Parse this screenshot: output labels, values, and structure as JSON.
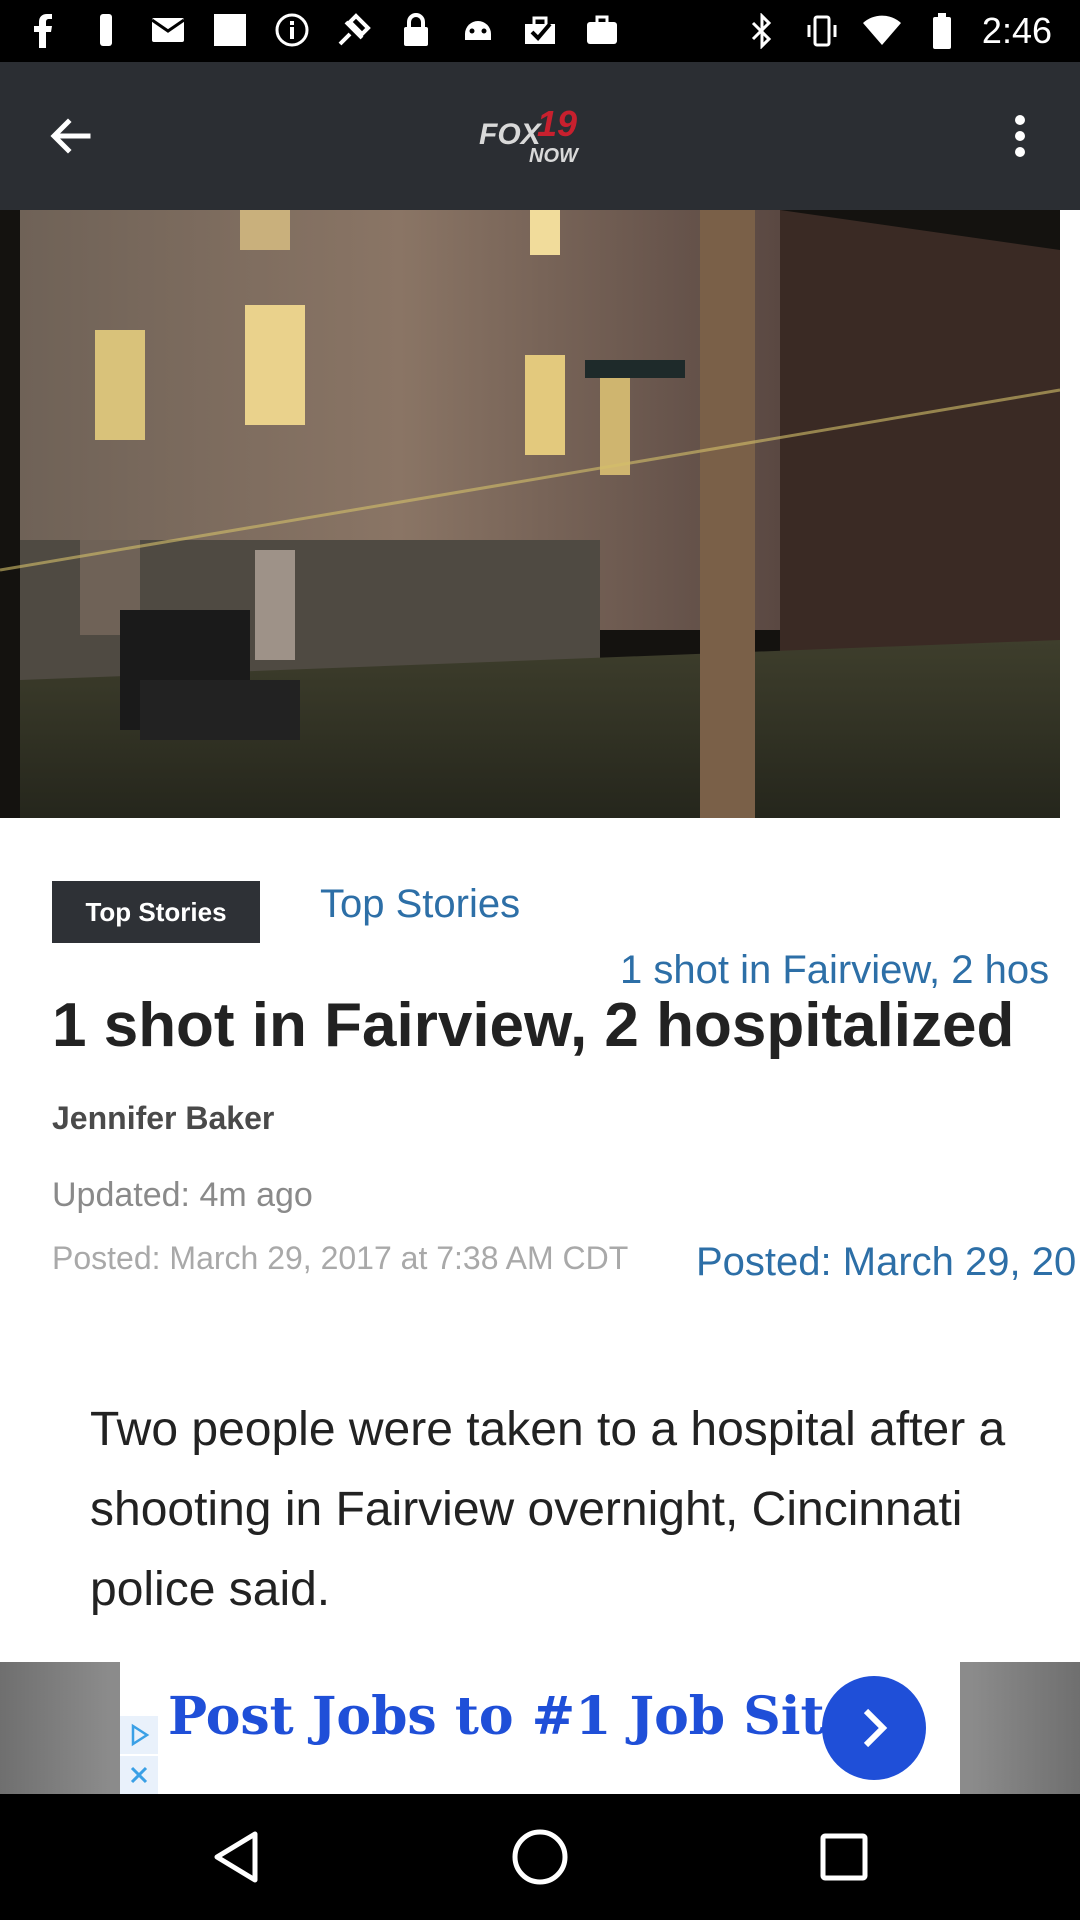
{
  "status_bar": {
    "time": "2:46",
    "left_icons": [
      "facebook-icon",
      "notification-icon",
      "mail-icon",
      "blank-icon",
      "info-icon",
      "fake-gps-icon",
      "lock-icon",
      "android-icon",
      "clipboard-check-icon",
      "briefcase-icon"
    ],
    "right_icons": [
      "bluetooth-icon",
      "vibrate-icon",
      "wifi-icon",
      "battery-icon"
    ]
  },
  "app_bar": {
    "logo_text_top": "FOX",
    "logo_number": "19",
    "logo_text_bottom": "NOW"
  },
  "article": {
    "tag": "Top Stories",
    "section_link": "Top Stories",
    "overflow_title": "1 shot in Fairview, 2 hos",
    "headline": "1 shot in Fairview, 2 hospitalized",
    "author": "Jennifer Baker",
    "updated": "Updated: 4m ago",
    "posted": "Posted: March 29, 2017 at 7:38 AM CDT",
    "posted_link": "Posted: March 29, 20",
    "body": "Two people were taken to a hospital after a shooting in Fairview overnight, Cincinnati police said."
  },
  "ad": {
    "text": "Post Jobs to #1 Job Site"
  },
  "colors": {
    "app_bar": "#2b2e33",
    "link_blue": "#2d6fa7",
    "ad_blue": "#1f4fd8"
  }
}
